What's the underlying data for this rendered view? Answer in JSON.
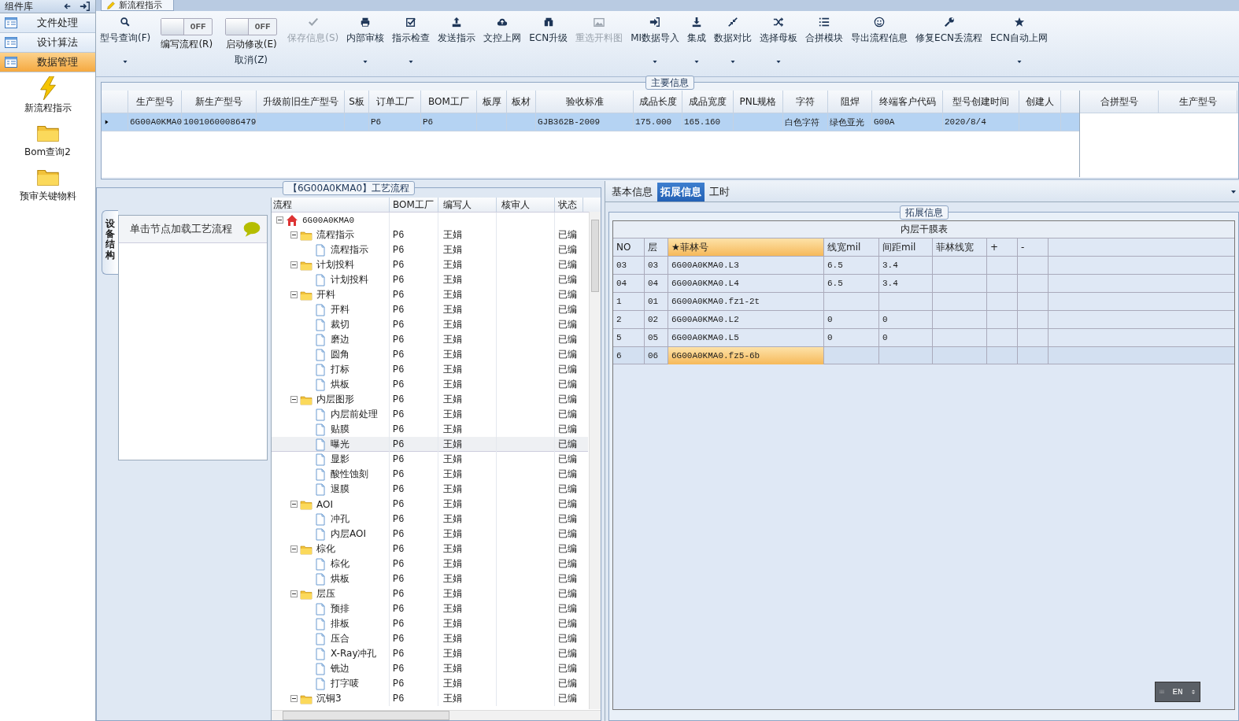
{
  "sidebar": {
    "title": "组件库",
    "nav": [
      {
        "label": "文件处理",
        "selected": false
      },
      {
        "label": "设计算法",
        "selected": false
      },
      {
        "label": "数据管理",
        "selected": true
      }
    ],
    "shortcuts": [
      {
        "label": "新流程指示"
      },
      {
        "label": "Bom查询2"
      },
      {
        "label": "预审关键物料"
      }
    ]
  },
  "document_tab": {
    "label": "新流程指示"
  },
  "toolbar": [
    {
      "kind": "button",
      "label": "型号查询(F)",
      "dropdown": true,
      "disabled": false
    },
    {
      "kind": "toggle",
      "label": "编写流程(R)",
      "state": "OFF",
      "on": false
    },
    {
      "kind": "toggle",
      "label": "启动修改(E)",
      "sublabel": "取消(Z)",
      "state": "OFF",
      "on": false
    },
    {
      "kind": "button",
      "label": "保存信息(S)",
      "dropdown": false,
      "disabled": true
    },
    {
      "kind": "button",
      "label": "内部审核",
      "dropdown": true,
      "disabled": false
    },
    {
      "kind": "button",
      "label": "指示检查",
      "dropdown": true,
      "disabled": false
    },
    {
      "kind": "button",
      "label": "发送指示",
      "dropdown": false,
      "disabled": false
    },
    {
      "kind": "button",
      "label": "文控上网",
      "dropdown": false,
      "disabled": false
    },
    {
      "kind": "button",
      "label": "ECN升级",
      "dropdown": false,
      "disabled": false
    },
    {
      "kind": "button",
      "label": "重选开料图",
      "dropdown": false,
      "disabled": true
    },
    {
      "kind": "button",
      "label": "MI数据导入",
      "dropdown": true,
      "disabled": false
    },
    {
      "kind": "button",
      "label": "集成",
      "dropdown": true,
      "disabled": false
    },
    {
      "kind": "button",
      "label": "数据对比",
      "dropdown": true,
      "disabled": false
    },
    {
      "kind": "button",
      "label": "选择母板",
      "dropdown": true,
      "disabled": false
    },
    {
      "kind": "button",
      "label": "合拼模块",
      "dropdown": false,
      "disabled": false
    },
    {
      "kind": "button",
      "label": "导出流程信息",
      "dropdown": false,
      "disabled": false
    },
    {
      "kind": "button",
      "label": "修复ECN丢流程",
      "dropdown": false,
      "disabled": false
    },
    {
      "kind": "button",
      "label": "ECN自动上网",
      "dropdown": true,
      "disabled": false
    }
  ],
  "main_info": {
    "title": "主要信息",
    "columns": [
      "生产型号",
      "新生产型号",
      "升级前旧生产型号",
      "S板",
      "订单工厂",
      "BOM工厂",
      "板厚",
      "板材",
      "验收标准",
      "成品长度",
      "成品宽度",
      "PNL规格",
      "字符",
      "阻焊",
      "终端客户代码",
      "型号创建时间",
      "创建人"
    ],
    "rows": [
      {
        "selected": true,
        "cells": [
          "6G00A0KMA0",
          "10010600086479",
          null,
          null,
          "P6",
          "P6",
          null,
          null,
          "GJB362B-2009",
          "175.000",
          "165.160",
          null,
          "白色字符",
          "绿色亚光",
          "G00A",
          "2020/8/4",
          null
        ]
      }
    ],
    "side_columns": [
      "合拼型号",
      "生产型号"
    ]
  },
  "process": {
    "title": "【6G00A0KMA0】工艺流程",
    "side_tab": "设备结构",
    "hint": "单击节点加载工艺流程",
    "columns": [
      "流程",
      "BOM工厂",
      "编写人",
      "核审人",
      "状态"
    ],
    "tree": [
      {
        "kind": "root",
        "label": "6G00A0KMA0",
        "expanded": true,
        "selected": false,
        "children": [
          {
            "kind": "folder",
            "label": "流程指示",
            "bom": "P6",
            "writer": "王娟",
            "status": "已编",
            "expanded": true,
            "selected": false,
            "children": [
              {
                "kind": "file",
                "label": "流程指示",
                "bom": "P6",
                "writer": "王娟",
                "status": "已编",
                "selected": false
              }
            ]
          },
          {
            "kind": "folder",
            "label": "计划投料",
            "bom": "P6",
            "writer": "王娟",
            "status": "已编",
            "expanded": true,
            "selected": false,
            "children": [
              {
                "kind": "file",
                "label": "计划投料",
                "bom": "P6",
                "writer": "王娟",
                "status": "已编",
                "selected": false
              }
            ]
          },
          {
            "kind": "folder",
            "label": "开料",
            "bom": "P6",
            "writer": "王娟",
            "status": "已编",
            "expanded": true,
            "selected": false,
            "children": [
              {
                "kind": "file",
                "label": "开料",
                "bom": "P6",
                "writer": "王娟",
                "status": "已编",
                "selected": false
              },
              {
                "kind": "file",
                "label": "裁切",
                "bom": "P6",
                "writer": "王娟",
                "status": "已编",
                "selected": false
              },
              {
                "kind": "file",
                "label": "磨边",
                "bom": "P6",
                "writer": "王娟",
                "status": "已编",
                "selected": false
              },
              {
                "kind": "file",
                "label": "圆角",
                "bom": "P6",
                "writer": "王娟",
                "status": "已编",
                "selected": false
              },
              {
                "kind": "file",
                "label": "打标",
                "bom": "P6",
                "writer": "王娟",
                "status": "已编",
                "selected": false
              },
              {
                "kind": "file",
                "label": "烘板",
                "bom": "P6",
                "writer": "王娟",
                "status": "已编",
                "selected": false
              }
            ]
          },
          {
            "kind": "folder",
            "label": "内层图形",
            "bom": "P6",
            "writer": "王娟",
            "status": "已编",
            "expanded": true,
            "selected": false,
            "children": [
              {
                "kind": "file",
                "label": "内层前处理",
                "bom": "P6",
                "writer": "王娟",
                "status": "已编",
                "selected": false
              },
              {
                "kind": "file",
                "label": "贴膜",
                "bom": "P6",
                "writer": "王娟",
                "status": "已编",
                "selected": false
              },
              {
                "kind": "file",
                "label": "曝光",
                "bom": "P6",
                "writer": "王娟",
                "status": "已编",
                "selected": true
              },
              {
                "kind": "file",
                "label": "显影",
                "bom": "P6",
                "writer": "王娟",
                "status": "已编",
                "selected": false
              },
              {
                "kind": "file",
                "label": "酸性蚀刻",
                "bom": "P6",
                "writer": "王娟",
                "status": "已编",
                "selected": false
              },
              {
                "kind": "file",
                "label": "退膜",
                "bom": "P6",
                "writer": "王娟",
                "status": "已编",
                "selected": false
              }
            ]
          },
          {
            "kind": "folder",
            "label": "AOI",
            "bom": "P6",
            "writer": "王娟",
            "status": "已编",
            "expanded": true,
            "selected": false,
            "children": [
              {
                "kind": "file",
                "label": "冲孔",
                "bom": "P6",
                "writer": "王娟",
                "status": "已编",
                "selected": false
              },
              {
                "kind": "file",
                "label": "内层AOI",
                "bom": "P6",
                "writer": "王娟",
                "status": "已编",
                "selected": false
              }
            ]
          },
          {
            "kind": "folder",
            "label": "棕化",
            "bom": "P6",
            "writer": "王娟",
            "status": "已编",
            "expanded": true,
            "selected": false,
            "children": [
              {
                "kind": "file",
                "label": "棕化",
                "bom": "P6",
                "writer": "王娟",
                "status": "已编",
                "selected": false
              },
              {
                "kind": "file",
                "label": "烘板",
                "bom": "P6",
                "writer": "王娟",
                "status": "已编",
                "selected": false
              }
            ]
          },
          {
            "kind": "folder",
            "label": "层压",
            "bom": "P6",
            "writer": "王娟",
            "status": "已编",
            "expanded": true,
            "selected": false,
            "children": [
              {
                "kind": "file",
                "label": "预排",
                "bom": "P6",
                "writer": "王娟",
                "status": "已编",
                "selected": false
              },
              {
                "kind": "file",
                "label": "排板",
                "bom": "P6",
                "writer": "王娟",
                "status": "已编",
                "selected": false
              },
              {
                "kind": "file",
                "label": "压合",
                "bom": "P6",
                "writer": "王娟",
                "status": "已编",
                "selected": false
              },
              {
                "kind": "file",
                "label": "X-Ray冲孔",
                "bom": "P6",
                "writer": "王娟",
                "status": "已编",
                "selected": false
              },
              {
                "kind": "file",
                "label": "铣边",
                "bom": "P6",
                "writer": "王娟",
                "status": "已编",
                "selected": false
              },
              {
                "kind": "file",
                "label": "打字唛",
                "bom": "P6",
                "writer": "王娟",
                "status": "已编",
                "selected": false
              }
            ]
          },
          {
            "kind": "folder",
            "label": "沉铜3",
            "bom": "P6",
            "writer": "王娟",
            "status": "已编",
            "expanded": true,
            "selected": false
          }
        ]
      }
    ]
  },
  "detail": {
    "tabs": [
      {
        "label": "基本信息",
        "selected": false
      },
      {
        "label": "拓展信息",
        "selected": true
      },
      {
        "label": "工时",
        "selected": false
      }
    ],
    "group_title": "拓展信息",
    "table_title": "内层干膜表",
    "columns": [
      {
        "label": "NO",
        "highlighted": false
      },
      {
        "label": "层",
        "highlighted": false
      },
      {
        "label": "★菲林号",
        "highlighted": true
      },
      {
        "label": "线宽mil",
        "highlighted": false
      },
      {
        "label": "间距mil",
        "highlighted": false
      },
      {
        "label": "菲林线宽",
        "highlighted": false
      },
      {
        "label": "+",
        "highlighted": false
      },
      {
        "label": "-",
        "highlighted": false
      }
    ],
    "rows": [
      {
        "selected": false,
        "cells": [
          "03",
          "03",
          "6G00A0KMA0.L3",
          "6.5",
          "3.4",
          null,
          null,
          null
        ]
      },
      {
        "selected": false,
        "cells": [
          "04",
          "04",
          "6G00A0KMA0.L4",
          "6.5",
          "3.4",
          null,
          null,
          null
        ]
      },
      {
        "selected": false,
        "cells": [
          "1",
          "01",
          "6G00A0KMA0.fz1-2t",
          null,
          null,
          null,
          null,
          null
        ]
      },
      {
        "selected": false,
        "cells": [
          "2",
          "02",
          "6G00A0KMA0.L2",
          "0",
          "0",
          null,
          null,
          null
        ]
      },
      {
        "selected": false,
        "cells": [
          "5",
          "05",
          "6G00A0KMA0.L5",
          "0",
          "0",
          null,
          null,
          null
        ]
      },
      {
        "selected": true,
        "cells": [
          "6",
          "06",
          "6G00A0KMA0.fz5-6b",
          null,
          null,
          null,
          null,
          null
        ]
      }
    ]
  },
  "language": {
    "label": "EN"
  }
}
